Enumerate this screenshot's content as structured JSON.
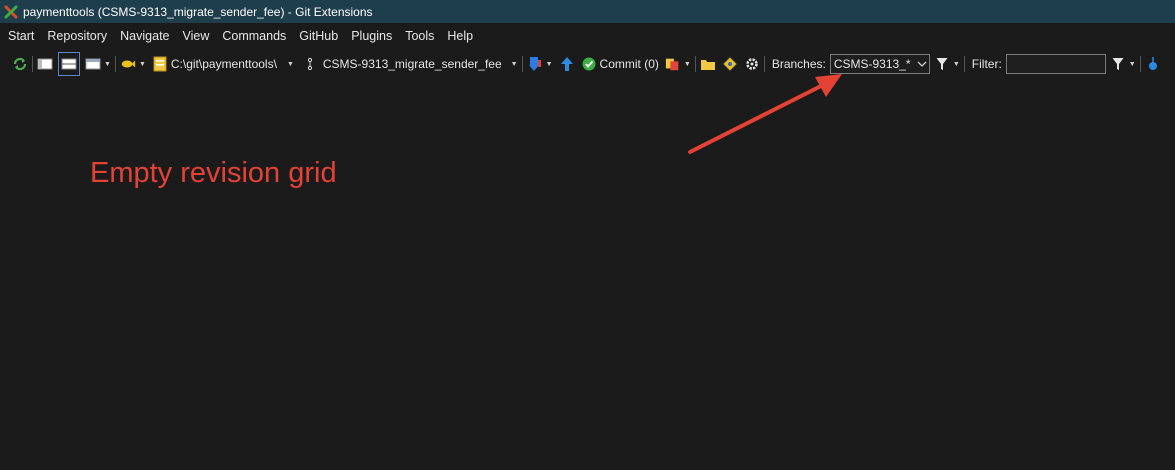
{
  "window": {
    "title": "paymenttools (CSMS-9313_migrate_sender_fee) - Git Extensions"
  },
  "menu": {
    "items": [
      "Start",
      "Repository",
      "Navigate",
      "View",
      "Commands",
      "GitHub",
      "Plugins",
      "Tools",
      "Help"
    ]
  },
  "toolbar": {
    "repo_path": "C:\\git\\paymenttools\\",
    "branch_name": "CSMS-9313_migrate_sender_fee",
    "commit_label": "Commit (0)",
    "branches_label": "Branches:",
    "branches_value": "CSMS-9313_*",
    "filter_label": "Filter:",
    "filter_value": ""
  },
  "annotation": {
    "text": "Empty revision grid",
    "color": "#e34234"
  },
  "colors": {
    "titlebar": "#1f3e4c",
    "background": "#1b1b1b"
  }
}
